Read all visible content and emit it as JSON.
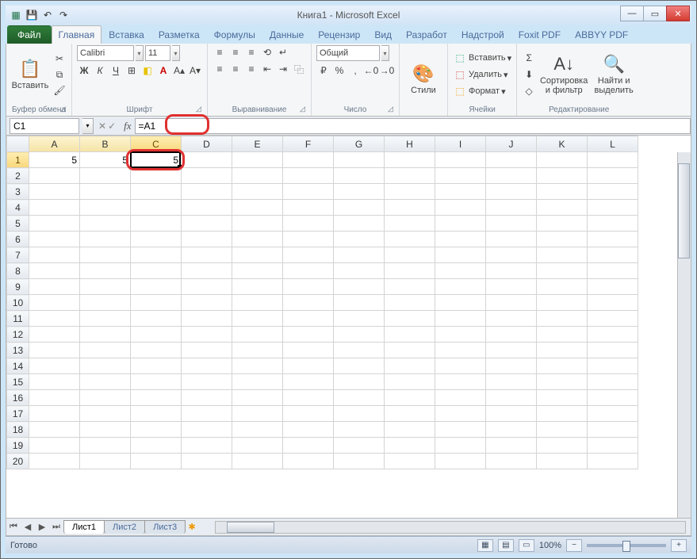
{
  "window": {
    "title": "Книга1  -  Microsoft Excel"
  },
  "tabs": {
    "file": "Файл",
    "items": [
      "Главная",
      "Вставка",
      "Разметка",
      "Формулы",
      "Данные",
      "Рецензир",
      "Вид",
      "Разработ",
      "Надстрой",
      "Foxit PDF",
      "ABBYY PDF"
    ],
    "active_index": 0
  },
  "ribbon": {
    "clipboard": {
      "paste": "Вставить",
      "label": "Буфер обмена"
    },
    "font": {
      "name": "Calibri",
      "size": "11",
      "label": "Шрифт"
    },
    "alignment": {
      "label": "Выравнивание"
    },
    "number": {
      "format": "Общий",
      "label": "Число"
    },
    "styles": {
      "btn": "Стили",
      "label": ""
    },
    "cells": {
      "insert": "Вставить",
      "delete": "Удалить",
      "format": "Формат",
      "label": "Ячейки"
    },
    "editing": {
      "sort": "Сортировка и фильтр",
      "find": "Найти и выделить",
      "label": "Редактирование"
    }
  },
  "formula_bar": {
    "name_box": "C1",
    "formula": "=A1"
  },
  "grid": {
    "columns": [
      "A",
      "B",
      "C",
      "D",
      "E",
      "F",
      "G",
      "H",
      "I",
      "J",
      "K",
      "L"
    ],
    "rows": 20,
    "selected_col_idx": 2,
    "highlighted_cols": [
      0,
      1
    ],
    "selected_row": 1,
    "cells": {
      "A1": "5",
      "B1": "5",
      "C1": "5"
    },
    "selection": {
      "col": 2,
      "row": 1
    }
  },
  "sheet_tabs": {
    "items": [
      "Лист1",
      "Лист2",
      "Лист3"
    ],
    "active_index": 0
  },
  "status": {
    "ready": "Готово",
    "zoom": "100%"
  },
  "icons": {
    "excel": "▦",
    "save": "💾",
    "undo": "↶",
    "redo": "↷",
    "min": "—",
    "max": "▭",
    "close": "✕",
    "cut": "✂",
    "copy": "⧉",
    "brush": "🖌",
    "bold": "Ж",
    "italic": "К",
    "underline": "Ч",
    "border": "⊞",
    "fill": "◧",
    "fontcolor": "A",
    "grow": "A▴",
    "shrink": "A▾",
    "at": "≡",
    "am": "≡",
    "ab": "≡",
    "al": "≡",
    "ac": "≡",
    "ar": "≡",
    "wrap": "↵",
    "merge": "⿻",
    "indm": "⇤",
    "indp": "⇥",
    "orient": "⟲",
    "currency": "₽",
    "percent": "%",
    "comma": ",",
    "incdec": "←0",
    "decdec": "→0",
    "styles": "🎨",
    "insrow": "⬚",
    "delrow": "⬚",
    "fmt": "⬚",
    "sigma": "Σ",
    "filld": "⬇",
    "clear": "◇",
    "sort": "A↓",
    "find": "🔍",
    "sb_l1": "⏮",
    "sb_l2": "◀",
    "sb_r1": "▶",
    "sb_r2": "⏭",
    "newtab": "✱",
    "v1": "▦",
    "v2": "▤",
    "v3": "▭",
    "zminus": "−",
    "zplus": "+"
  }
}
